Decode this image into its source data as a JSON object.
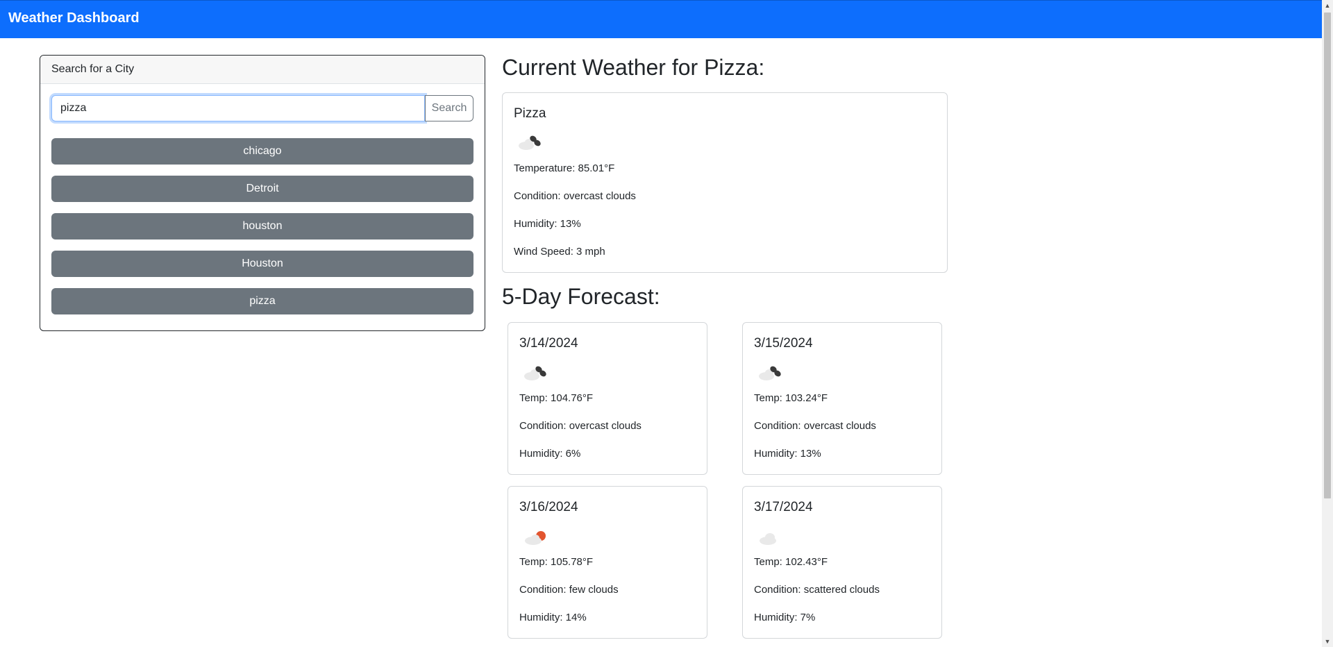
{
  "navbar": {
    "title": "Weather Dashboard"
  },
  "search": {
    "header": "Search for a City",
    "input_value": "pizza",
    "button_label": "Search",
    "history": [
      "chicago",
      "Detroit",
      "houston",
      "Houston",
      "pizza"
    ]
  },
  "current": {
    "heading": "Current Weather for Pizza:",
    "city": "Pizza",
    "icon": "broken-clouds-icon",
    "temperature": "Temperature: 85.01°F",
    "condition": "Condition: overcast clouds",
    "humidity": "Humidity: 13%",
    "wind": "Wind Speed: 3 mph"
  },
  "forecast": {
    "heading": "5-Day Forecast:",
    "days": [
      {
        "date": "3/14/2024",
        "icon": "broken-clouds-icon",
        "temp": "Temp: 104.76°F",
        "condition": "Condition: overcast clouds",
        "humidity": "Humidity: 6%"
      },
      {
        "date": "3/15/2024",
        "icon": "broken-clouds-icon",
        "temp": "Temp: 103.24°F",
        "condition": "Condition: overcast clouds",
        "humidity": "Humidity: 13%"
      },
      {
        "date": "3/16/2024",
        "icon": "few-clouds-icon",
        "temp": "Temp: 105.78°F",
        "condition": "Condition: few clouds",
        "humidity": "Humidity: 14%"
      },
      {
        "date": "3/17/2024",
        "icon": "scattered-clouds-icon",
        "temp": "Temp: 102.43°F",
        "condition": "Condition: scattered clouds",
        "humidity": "Humidity: 7%"
      }
    ]
  },
  "colors": {
    "navbar": "#0d6efd",
    "history_button": "#6c757d",
    "cloud_dark": "#3a3a3a",
    "cloud_light": "#e9e9e9",
    "sun": "#e2552f"
  }
}
